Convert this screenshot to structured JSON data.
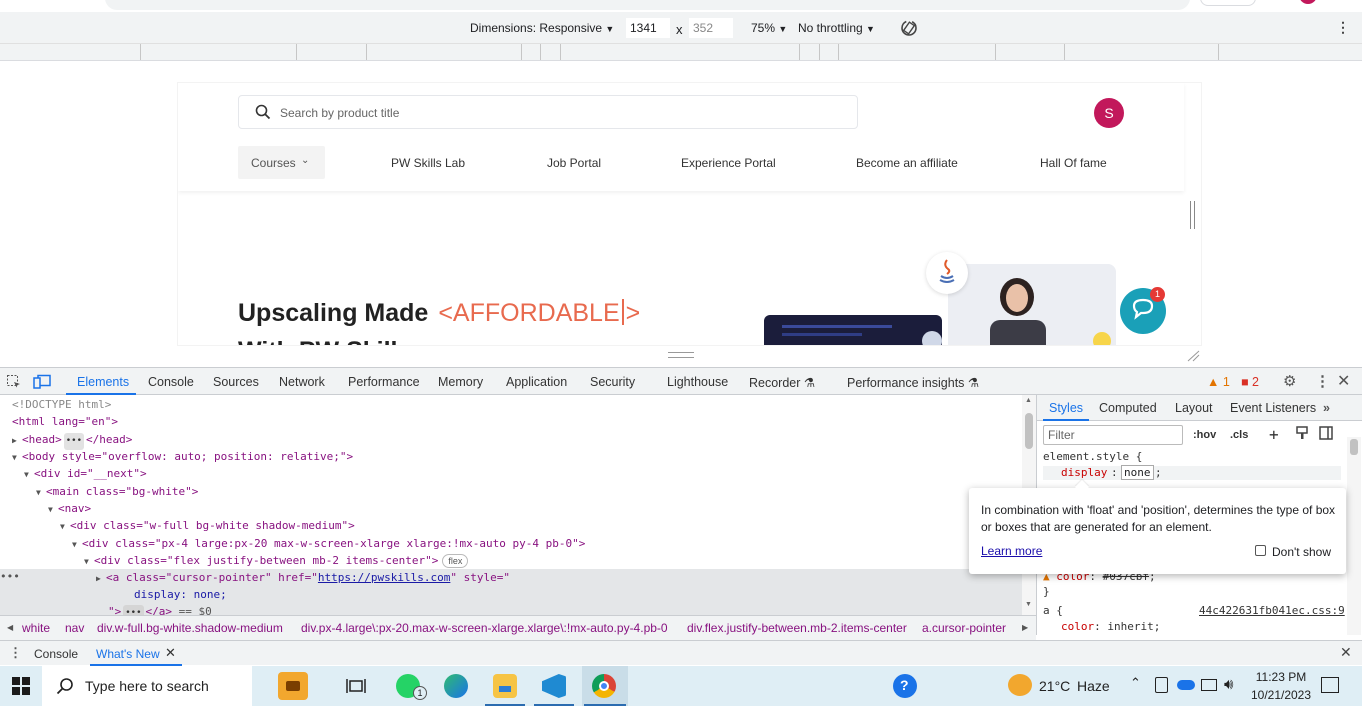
{
  "device_toolbar": {
    "dimensions_label": "Dimensions: Responsive",
    "width_value": "1341",
    "times": "x",
    "height_value": "352",
    "zoom": "75%",
    "throttling": "No throttling"
  },
  "site": {
    "search_placeholder": "Search by product title",
    "avatar_letter": "S",
    "nav": {
      "courses": "Courses",
      "lab": "PW Skills Lab",
      "jobs": "Job Portal",
      "experience": "Experience Portal",
      "affiliate": "Become an affiliate",
      "fame": "Hall Of fame"
    },
    "hero_title": "Upscaling Made",
    "hero_affordable_open": "<AFFORDABLE",
    "hero_affordable_close": ">",
    "hero_sub": "With PW Skills",
    "chat_badge": "1"
  },
  "devtools": {
    "tabs": [
      "Elements",
      "Console",
      "Sources",
      "Network",
      "Performance",
      "Memory",
      "Application",
      "Security",
      "Lighthouse",
      "Recorder",
      "Performance insights"
    ],
    "warnings": "1",
    "errors": "2",
    "dom": {
      "doctype": "<!DOCTYPE html>",
      "html_open": "<html lang=\"en\">",
      "head": "<head>",
      "head_close": "</head>",
      "body": "<body style=\"overflow: auto; position: relative;\">",
      "next": "<div id=\"__next\">",
      "main": "<main class=\"bg-white\">",
      "nav": "<nav>",
      "div1": "<div class=\"w-full bg-white shadow-medium\">",
      "div2": "<div class=\"px-4 large:px-20 max-w-screen-xlarge xlarge:!mx-auto py-4 pb-0\">",
      "div3": "<div class=\"flex justify-between mb-2 items-center\">",
      "flex_pill": "flex",
      "a_open_pre": "<a class=\"cursor-pointer\" href=\"",
      "a_href": "https://pwskills.com",
      "a_open_post": "\" style=\"",
      "a_style": "display: none;",
      "a_close": "\">",
      "a_end": "</a>",
      "a_eq": "== $0"
    },
    "styles_tabs": [
      "Styles",
      "Computed",
      "Layout",
      "Event Listeners"
    ],
    "filter_placeholder": "Filter",
    "hov": ":hov",
    ".cls": ".cls",
    "element_style": "element.style {",
    "prop_display": "display",
    "value_none": "none",
    "color_line_prop": "color",
    "color_line_val": "#037cbf",
    "brace_close": "}",
    "a_rule": "a {",
    "a_source": "44c422631fb041ec.css:9",
    "color_inherit_prop": "color",
    "color_inherit_val": "inherit;",
    "tooltip": {
      "text": "In combination with 'float' and 'position', determines the type of box or boxes that are generated for an element.",
      "learn_more": "Learn more",
      "dont_show": "Don't show"
    },
    "breadcrumb": [
      "white",
      "nav",
      "div.w-full.bg-white.shadow-medium",
      "div.px-4.large\\:px-20.max-w-screen-xlarge.xlarge\\:!mx-auto.py-4.pb-0",
      "div.flex.justify-between.mb-2.items-center",
      "a.cursor-pointer"
    ],
    "drawer_tabs": [
      "Console",
      "What's New"
    ]
  },
  "taskbar": {
    "search_placeholder": "Type here to search",
    "whatsapp_badge": "1",
    "weather_temp": "21°C",
    "weather_desc": "Haze",
    "time": "11:23 PM",
    "date": "10/21/2023"
  },
  "colors": {
    "accent": "#1a73e8",
    "avatar": "#c2185b",
    "affordable": "#e86a4e",
    "chat": "#1aa0b8"
  }
}
